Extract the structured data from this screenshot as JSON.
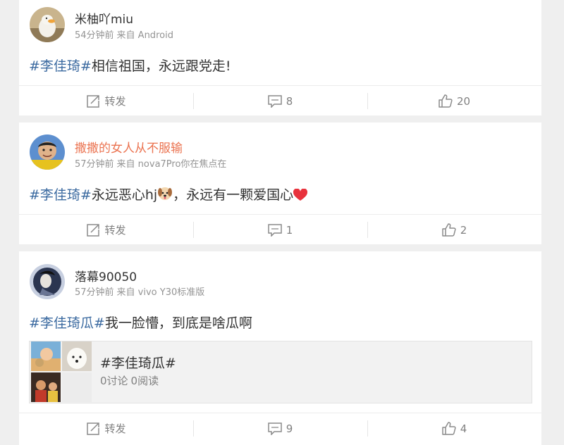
{
  "posts": [
    {
      "username": "米柚吖miu",
      "time": "54分钟前",
      "source": "来自 Android",
      "topic": "#李佳琦#",
      "text": "相信祖国，永远跟党走!",
      "actions": {
        "repost": "转发",
        "comments": "8",
        "likes": "20"
      }
    },
    {
      "username": "撒撒的女人从不服输",
      "time": "57分钟前",
      "source": "来自 nova7Pro你在焦点在",
      "topic": "#李佳琦#",
      "text_before": "永远恶心hj",
      "text_after": "，永远有一颗爱国心",
      "actions": {
        "repost": "转发",
        "comments": "1",
        "likes": "2"
      }
    },
    {
      "username": "落幕90050",
      "time": "57分钟前",
      "source": "来自 vivo Y30标准版",
      "topic": "#李佳琦瓜#",
      "text": "我一脸懵，到底是啥瓜啊",
      "topic_card": {
        "title": "#李佳琦瓜#",
        "discussions": "0讨论",
        "reads": "0阅读"
      },
      "actions": {
        "repost": "转发",
        "comments": "9",
        "likes": "4"
      }
    }
  ],
  "colors": {
    "topic": "#3b6aa0",
    "vip_name": "#eb7350",
    "meta": "#939393"
  },
  "icons": {
    "repost": "share-square-icon",
    "comment": "comment-bubble-icon",
    "like": "thumbs-up-icon"
  }
}
